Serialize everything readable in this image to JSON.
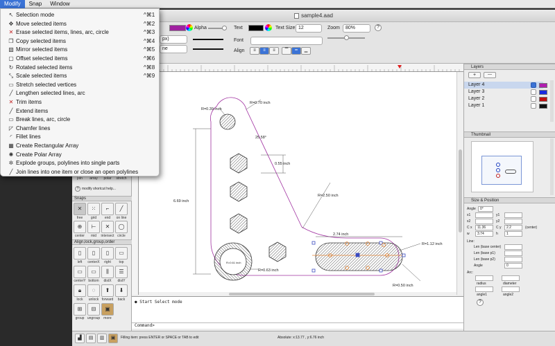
{
  "menubar": {
    "items": [
      "Modify",
      "Snap",
      "Window"
    ]
  },
  "menu": {
    "items": [
      {
        "label": "Selection mode",
        "shortcut": "^⌘1",
        "icon": "arrow-icon"
      },
      {
        "label": "Move selected items",
        "shortcut": "^⌘2",
        "icon": "move-icon"
      },
      {
        "label": "Erase selected items, lines, arc, circle",
        "shortcut": "^⌘3",
        "icon": "erase-icon"
      },
      {
        "label": "Copy selected items",
        "shortcut": "^⌘4",
        "icon": "copy-icon"
      },
      {
        "label": "Mirror selected items",
        "shortcut": "^⌘5",
        "icon": "mirror-icon"
      },
      {
        "label": "Offset selected items",
        "shortcut": "^⌘6",
        "icon": "offset-icon"
      },
      {
        "label": "Rotated selected items",
        "shortcut": "^⌘8",
        "icon": "rotate-icon"
      },
      {
        "label": "Scale selected items",
        "shortcut": "^⌘9",
        "icon": "scale-icon"
      },
      {
        "label": "Stretch selected vertices",
        "shortcut": "",
        "icon": "stretch-icon"
      },
      {
        "label": "Lengthen selected lines, arc",
        "shortcut": "",
        "icon": "lengthen-icon"
      },
      {
        "label": "Trim items",
        "shortcut": "",
        "icon": "trim-icon"
      },
      {
        "label": "Extend items",
        "shortcut": "",
        "icon": "extend-icon"
      },
      {
        "label": "Break lines, arc, circle",
        "shortcut": "",
        "icon": "break-icon"
      },
      {
        "label": "Chamfer lines",
        "shortcut": "",
        "icon": "chamfer-icon"
      },
      {
        "label": "Fillet lines",
        "shortcut": "",
        "icon": "fillet-icon"
      },
      {
        "label": "Create Rectangular Array",
        "shortcut": "",
        "icon": "rect-array-icon"
      },
      {
        "label": "Create Polar Array",
        "shortcut": "",
        "icon": "polar-array-icon"
      },
      {
        "label": "Explode groups, polylines into single parts",
        "shortcut": "",
        "icon": "explode-icon"
      },
      {
        "label": "Join lines into one item or close an open polylines",
        "shortcut": "",
        "icon": "join-icon"
      }
    ]
  },
  "window": {
    "title": "sample4.aad"
  },
  "toolbar": {
    "alpha_label": "Alpha",
    "text_label": "Text",
    "text_size_label": "Text Size",
    "text_size_value": "12",
    "zoom_label": "Zoom",
    "zoom_value": "80%",
    "font_label": "Font",
    "align_label": "Align",
    "line_width_value": "px)",
    "line_type_value": "ne",
    "help_label": "?"
  },
  "left_panel": {
    "tools_row": [
      "join",
      "array",
      "polar",
      "stretch"
    ],
    "shortcut_help": "modify shortcut help...",
    "snaps_header": "Snaps",
    "snaps_row1": [
      "free",
      "grid",
      "end",
      "on line"
    ],
    "snaps_row2": [
      "center",
      "mid",
      "intersect",
      "circle"
    ],
    "align_header": "Align,lock,group,order",
    "align_row1": [
      "left",
      "centerX",
      "right",
      "top"
    ],
    "align_row2": [
      "centerY",
      "bottom",
      "distX",
      "distY"
    ],
    "align_row3": [
      "lock",
      "unlock",
      "forward",
      "back"
    ],
    "align_row4": [
      "group",
      "ungroup",
      "more"
    ]
  },
  "drawing": {
    "dims": {
      "r070": "R=0.70 inch",
      "r039": "R=0.39 inch",
      "angle": "25.58°",
      "d055": "0.55 inch",
      "r250": "R=2.50 inch",
      "d669": "6.69 inch",
      "d274": "2.74 inch",
      "r112": "R=1.12 inch",
      "r063": "R=0.63 inch",
      "r061": "R=0.61 inch",
      "r050": "R=0.50 inch"
    }
  },
  "console": {
    "log": "● Start Select mode",
    "prompt": "Command>"
  },
  "status": {
    "hint": "Filling item: press ENTER or SPACE or TAB to edit",
    "coords": "Absolute: x:13.77 , y:6.76 inch"
  },
  "right_panel": {
    "layers_header": "Layers",
    "add_label": "+",
    "remove_label": "—",
    "layers": [
      {
        "name": "Layer 4",
        "checked": true,
        "color": "#b020b0"
      },
      {
        "name": "Layer 3",
        "checked": false,
        "color": "#1a2be0"
      },
      {
        "name": "Layer 2",
        "checked": false,
        "color": "#c01010"
      },
      {
        "name": "Layer 1",
        "checked": false,
        "color": "#111111"
      }
    ],
    "thumbnail_header": "Thumbnail",
    "size_header": "Size & Position",
    "angle_label": "Angle",
    "angle_value": "0°",
    "x1_label": "x1",
    "y1_label": "y1",
    "x2_label": "x2",
    "y2_label": "y2",
    "cx_label": "C x",
    "cx_value": "11.36",
    "cy_label": "C y",
    "cy_value": "2.2",
    "center_label": "(center)",
    "w_label": "w",
    "w_value": "3.74",
    "h_label": "h",
    "h_value": "1",
    "line_label": "Line:",
    "len_center_label": "Len (base center)",
    "len_p1_label": "Len (base p1)",
    "len_p2_label": "Len (base p2)",
    "line_angle_label": "Angle",
    "line_angle_value": "0",
    "arc_label": "Arc:",
    "radius_label": "radius",
    "diameter_label": "diameter",
    "angle1_label": "angle1",
    "angle2_label": "angle2",
    "help_label": "?"
  }
}
